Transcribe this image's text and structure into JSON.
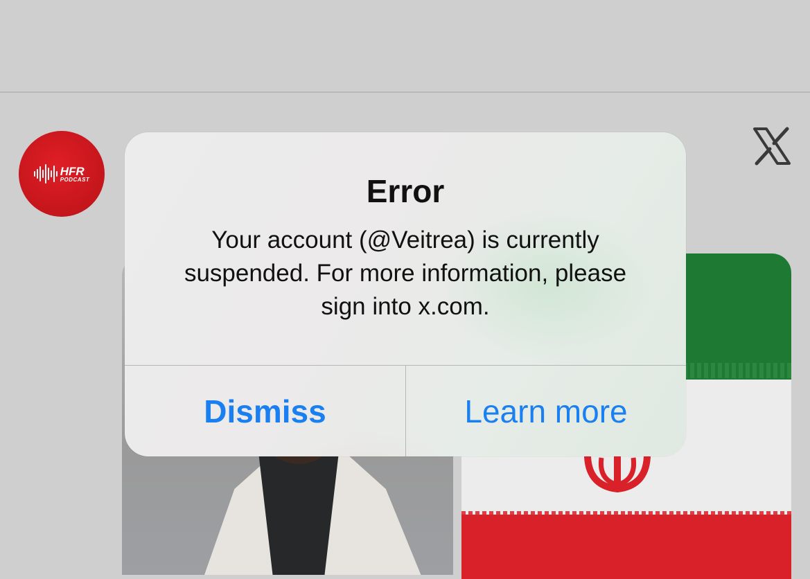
{
  "dialog": {
    "title": "Error",
    "message": "Your account (@Veitrea) is currently suspended. For more information, please sign into x.com.",
    "buttons": {
      "dismiss": "Dismiss",
      "learn_more": "Learn more"
    }
  },
  "tweet": {
    "avatar_brand": "HFR",
    "avatar_sub": "PODCAST"
  },
  "icons": [
    "x-logo-icon",
    "podcast-wave-icon"
  ],
  "colors": {
    "accent": "#1a7ff0",
    "avatar_red": "#d9212a"
  }
}
